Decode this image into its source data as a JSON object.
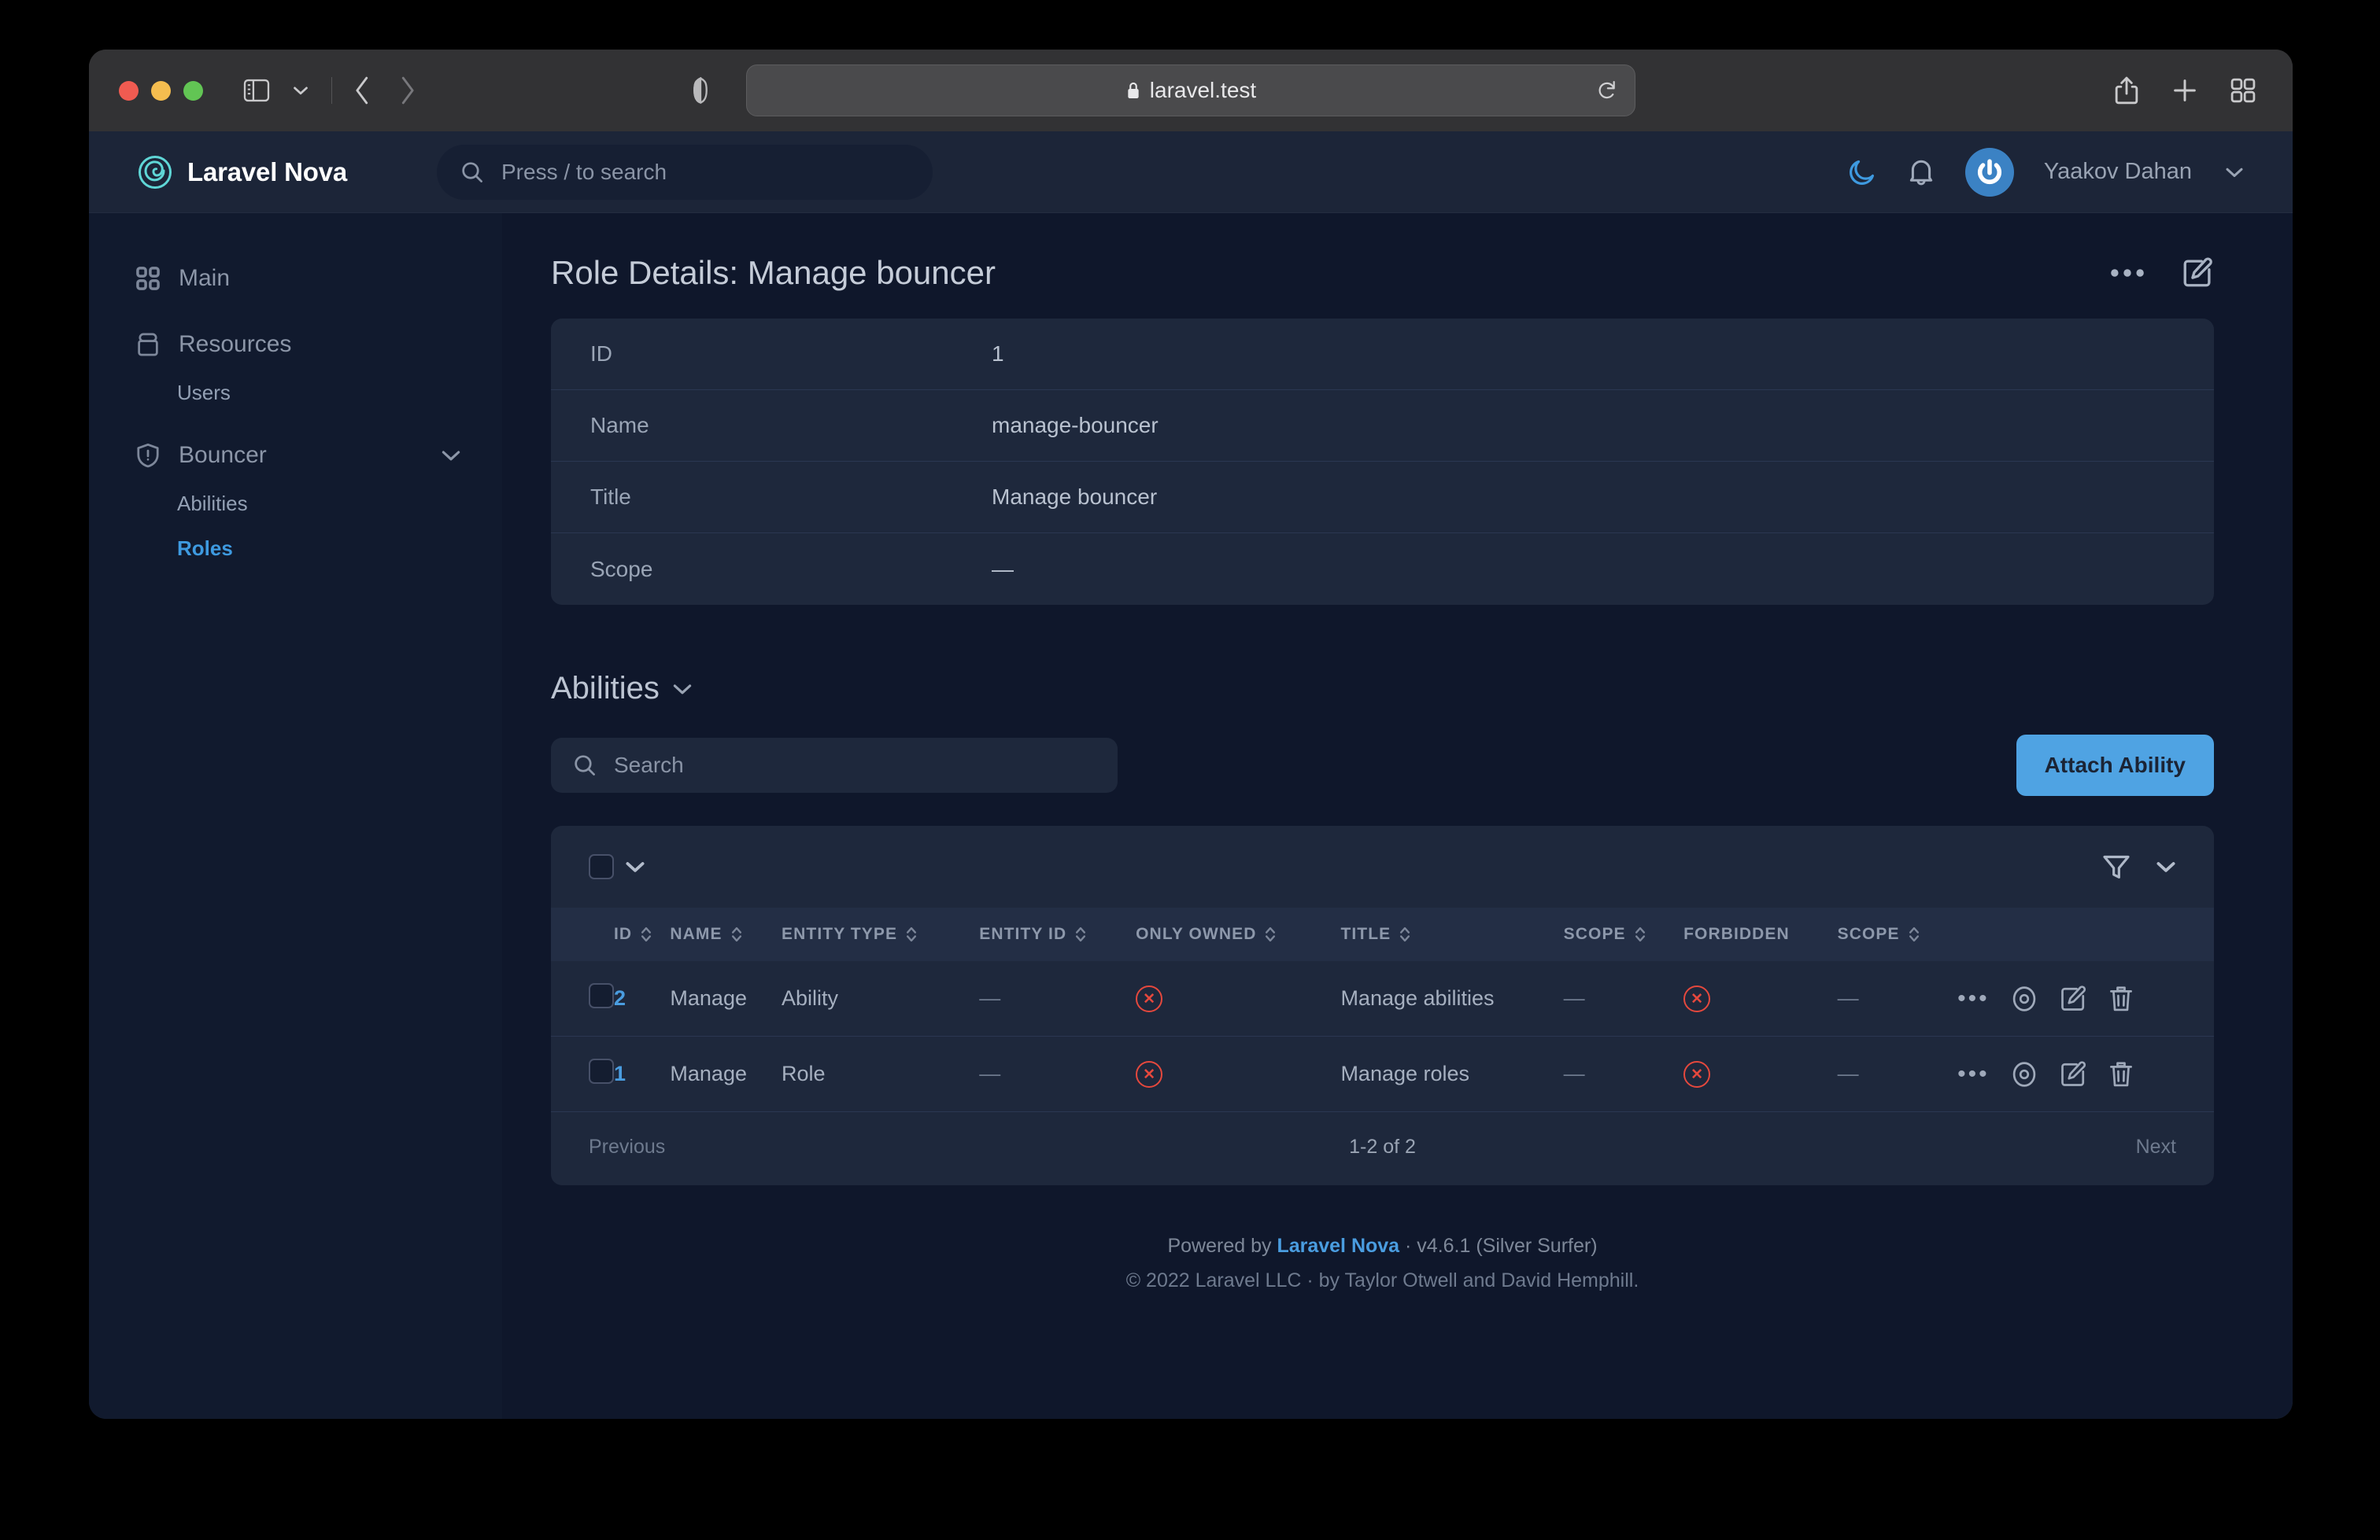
{
  "browser": {
    "url": "laravel.test",
    "lock_icon": "lock-icon",
    "reload_icon": "reload-icon",
    "shield_icon": "shield-privacy-icon",
    "sidebar_toggle_icon": "sidebar-toggle-icon",
    "back_icon": "chevron-left-icon",
    "forward_icon": "chevron-right-icon",
    "share_icon": "share-icon",
    "new_tab_icon": "plus-icon",
    "tab_overview_icon": "grid-icon",
    "traffic_lights": [
      "close",
      "minimize",
      "zoom"
    ]
  },
  "header": {
    "brand": "Laravel Nova",
    "brand_icon": "nova-spiral-logo",
    "search_placeholder": "Press / to search",
    "search_icon": "search-icon",
    "dark_mode_icon": "moon-icon",
    "notifications_icon": "bell-icon",
    "avatar_icon": "user-avatar",
    "user_name": "Yaakov Dahan",
    "user_chevron_icon": "chevron-down-icon"
  },
  "sidebar": {
    "groups": [
      {
        "label": "Main",
        "icon": "grid-squares-icon",
        "collapsible": false,
        "children": []
      },
      {
        "label": "Resources",
        "icon": "archive-box-icon",
        "collapsible": false,
        "children": [
          {
            "label": "Users",
            "active": false
          }
        ]
      },
      {
        "label": "Bouncer",
        "icon": "shield-alert-icon",
        "collapsible": true,
        "children": [
          {
            "label": "Abilities",
            "active": false
          },
          {
            "label": "Roles",
            "active": true
          }
        ]
      }
    ]
  },
  "page": {
    "title": "Role Details: Manage bouncer",
    "actions": [
      {
        "name": "more-actions",
        "icon": "ellipsis-icon"
      },
      {
        "name": "edit-resource",
        "icon": "edit-pencil-icon"
      }
    ],
    "detail_fields": [
      {
        "label": "ID",
        "value": "1"
      },
      {
        "label": "Name",
        "value": "manage-bouncer"
      },
      {
        "label": "Title",
        "value": "Manage bouncer"
      },
      {
        "label": "Scope",
        "value": "—"
      }
    ]
  },
  "relation": {
    "title": "Abilities",
    "title_chevron_icon": "chevron-down-icon",
    "search_placeholder": "Search",
    "search_icon": "search-icon",
    "attach_button": "Attach Ability",
    "select_all_checkbox": "select-all-checkbox",
    "select_all_chevron_icon": "chevron-down-icon",
    "filter_icon": "filter-funnel-icon",
    "filter_chevron_icon": "chevron-down-icon",
    "columns": [
      {
        "label": "ID",
        "sortable": true
      },
      {
        "label": "NAME",
        "sortable": true
      },
      {
        "label": "ENTITY TYPE",
        "sortable": true
      },
      {
        "label": "ENTITY ID",
        "sortable": true
      },
      {
        "label": "ONLY OWNED",
        "sortable": true
      },
      {
        "label": "TITLE",
        "sortable": true
      },
      {
        "label": "SCOPE",
        "sortable": true
      },
      {
        "label": "FORBIDDEN",
        "sortable": false
      },
      {
        "label": "SCOPE",
        "sortable": true
      }
    ],
    "rows": [
      {
        "id": "2",
        "name": "Manage",
        "entity_type": "Ability",
        "entity_id": "—",
        "only_owned": "x-circle-false",
        "title": "Manage abilities",
        "scope": "—",
        "forbidden": "x-circle-false",
        "scope2": "—",
        "actions": [
          "ellipsis-icon",
          "eye-icon",
          "edit-pencil-icon",
          "trash-icon"
        ]
      },
      {
        "id": "1",
        "name": "Manage",
        "entity_type": "Role",
        "entity_id": "—",
        "only_owned": "x-circle-false",
        "title": "Manage roles",
        "scope": "—",
        "forbidden": "x-circle-false",
        "scope2": "—",
        "actions": [
          "ellipsis-icon",
          "eye-icon",
          "edit-pencil-icon",
          "trash-icon"
        ]
      }
    ],
    "pagination": {
      "previous": "Previous",
      "count": "1-2 of 2",
      "next": "Next"
    }
  },
  "footer": {
    "powered_prefix": "Powered by ",
    "powered_brand": "Laravel Nova",
    "powered_suffix": " · v4.6.1 (Silver Surfer)",
    "copyright": "© 2022 Laravel LLC · by Taylor Otwell and David Hemphill."
  },
  "colors": {
    "accent_blue": "#4a9de0",
    "danger_red": "#e5483d",
    "app_bg": "#0f172b",
    "card_bg": "#1e283c",
    "sidebar_bg": "#111a2e"
  }
}
